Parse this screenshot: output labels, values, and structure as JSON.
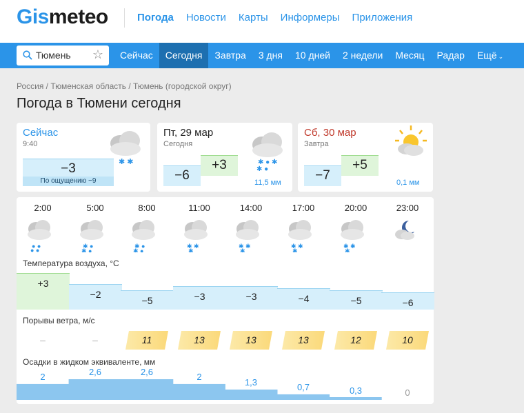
{
  "header": {
    "logo_a": "Gis",
    "logo_b": "meteo",
    "nav": [
      "Погода",
      "Новости",
      "Карты",
      "Информеры",
      "Приложения"
    ]
  },
  "menu": {
    "search_value": "Тюмень",
    "items": [
      "Сейчас",
      "Сегодня",
      "Завтра",
      "3 дня",
      "10 дней",
      "2 недели",
      "Месяц",
      "Радар",
      "Ещё"
    ],
    "active": "Сегодня"
  },
  "breadcrumb": "Россия / Тюменская область / Тюмень (городской округ)",
  "page_title": "Погода в Тюмени сегодня",
  "now": {
    "title": "Сейчас",
    "time": "9:40",
    "temp": "−3",
    "feels": "По ощущению −9"
  },
  "today": {
    "title": "Пт, 29 мар",
    "sub": "Сегодня",
    "tmin": "−6",
    "tmax": "+3",
    "precip": "11,5 мм"
  },
  "tomorrow": {
    "title": "Сб, 30 мар",
    "sub": "Завтра",
    "tmin": "−7",
    "tmax": "+5",
    "precip": "0,1 мм"
  },
  "hourly": {
    "times": [
      "2:00",
      "5:00",
      "8:00",
      "11:00",
      "14:00",
      "17:00",
      "20:00",
      "23:00"
    ],
    "icons": [
      "cloud-rain-icon",
      "cloud-snow-rain-icon",
      "cloud-snow-rain-icon",
      "cloud-snow-icon",
      "cloud-snow-icon",
      "cloud-snow-icon",
      "cloud-snow-icon",
      "moon-cloud-icon"
    ],
    "temp_label": "Температура воздуха, °C",
    "temps": [
      "+3",
      "−2",
      "−5",
      "−3",
      "−3",
      "−4",
      "−5",
      "−6"
    ],
    "temps_num": [
      3,
      -2,
      -5,
      -3,
      -3,
      -4,
      -5,
      -6
    ],
    "wind_label": "Порывы ветра, м/с",
    "wind": [
      "–",
      "–",
      "11",
      "13",
      "13",
      "13",
      "12",
      "10"
    ],
    "precip_label": "Осадки в жидком эквиваленте, мм",
    "precip": [
      "2",
      "2,6",
      "2,6",
      "2",
      "1,3",
      "0,7",
      "0,3",
      "0"
    ],
    "precip_num": [
      2,
      2.6,
      2.6,
      2,
      1.3,
      0.7,
      0.3,
      0
    ]
  },
  "colors": {
    "accent": "#2b94e8",
    "active_tab": "#1d6fb0",
    "cold": "#d6effb",
    "warm": "#dff5da",
    "wind": "#fbd97a"
  }
}
